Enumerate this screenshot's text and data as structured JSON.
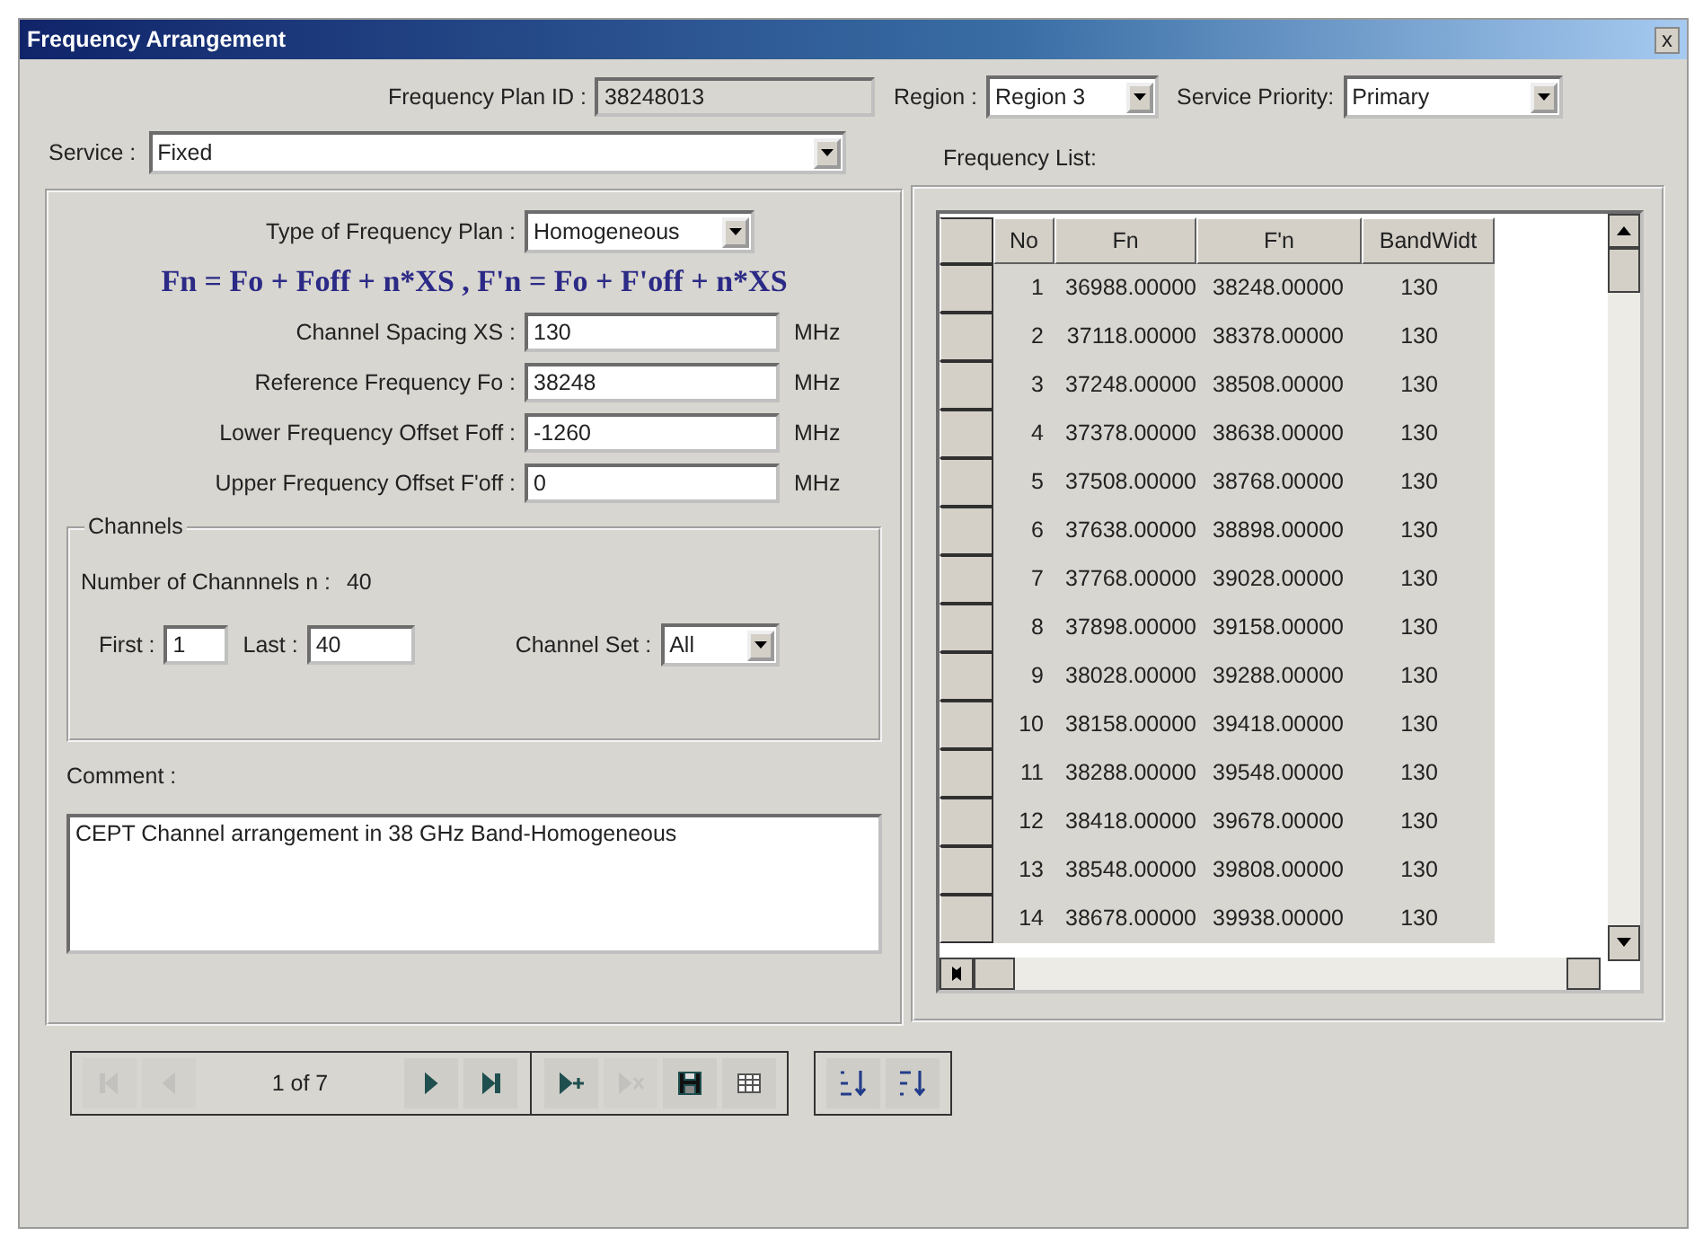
{
  "window": {
    "title": "Frequency Arrangement",
    "close": "x"
  },
  "plan_id": {
    "label": "Frequency Plan ID :",
    "value": "38248013"
  },
  "region": {
    "label": "Region :",
    "value": "Region 3"
  },
  "service_priority": {
    "label": "Service Priority:",
    "value": "Primary"
  },
  "service": {
    "label": "Service :",
    "value": "Fixed"
  },
  "plan": {
    "type_label": "Type of Frequency Plan :",
    "type_value": "Homogeneous",
    "formula": "Fn = Fo + Foff + n*XS , F'n = Fo + F'off + n*XS",
    "params": [
      {
        "label": "Channel Spacing  XS :",
        "value": "130",
        "unit": "MHz"
      },
      {
        "label": "Reference Frequency  Fo :",
        "value": "38248",
        "unit": "MHz"
      },
      {
        "label": "Lower Frequency Offset  Foff :",
        "value": "-1260",
        "unit": "MHz"
      },
      {
        "label": "Upper Frequency Offset  F'off :",
        "value": "0",
        "unit": "MHz"
      }
    ],
    "channels": {
      "title": "Channels",
      "count_label": "Number of Channnels  n :",
      "count_value": "40",
      "first_label": "First :",
      "first": "1",
      "last_label": "Last :",
      "last": "40",
      "set_label": "Channel Set :",
      "set_value": "All"
    },
    "comment_label": "Comment :",
    "comment": "CEPT Channel arrangement in 38 GHz Band-Homogeneous"
  },
  "frequency_list": {
    "label": "Frequency List:",
    "columns": [
      "No",
      "Fn",
      "F'n",
      "BandWidt"
    ],
    "rows": [
      {
        "no": "1",
        "fn": "36988.00000",
        "fpn": "38248.00000",
        "bw": "130"
      },
      {
        "no": "2",
        "fn": "37118.00000",
        "fpn": "38378.00000",
        "bw": "130"
      },
      {
        "no": "3",
        "fn": "37248.00000",
        "fpn": "38508.00000",
        "bw": "130"
      },
      {
        "no": "4",
        "fn": "37378.00000",
        "fpn": "38638.00000",
        "bw": "130"
      },
      {
        "no": "5",
        "fn": "37508.00000",
        "fpn": "38768.00000",
        "bw": "130"
      },
      {
        "no": "6",
        "fn": "37638.00000",
        "fpn": "38898.00000",
        "bw": "130"
      },
      {
        "no": "7",
        "fn": "37768.00000",
        "fpn": "39028.00000",
        "bw": "130"
      },
      {
        "no": "8",
        "fn": "37898.00000",
        "fpn": "39158.00000",
        "bw": "130"
      },
      {
        "no": "9",
        "fn": "38028.00000",
        "fpn": "39288.00000",
        "bw": "130"
      },
      {
        "no": "10",
        "fn": "38158.00000",
        "fpn": "39418.00000",
        "bw": "130"
      },
      {
        "no": "11",
        "fn": "38288.00000",
        "fpn": "39548.00000",
        "bw": "130"
      },
      {
        "no": "12",
        "fn": "38418.00000",
        "fpn": "39678.00000",
        "bw": "130"
      },
      {
        "no": "13",
        "fn": "38548.00000",
        "fpn": "39808.00000",
        "bw": "130"
      },
      {
        "no": "14",
        "fn": "38678.00000",
        "fpn": "39938.00000",
        "bw": "130"
      }
    ]
  },
  "navigator": {
    "position": "1 of 7",
    "buttons": [
      {
        "kind": "first",
        "disabled": true
      },
      {
        "kind": "prev",
        "disabled": true
      },
      {
        "kind": "next",
        "disabled": false
      },
      {
        "kind": "last",
        "disabled": false
      },
      {
        "kind": "add",
        "disabled": false
      },
      {
        "kind": "delete",
        "disabled": true
      },
      {
        "kind": "save",
        "disabled": false
      },
      {
        "kind": "grid",
        "disabled": false
      }
    ]
  },
  "sort_buttons": [
    {
      "kind": "asc"
    },
    {
      "kind": "desc"
    }
  ]
}
